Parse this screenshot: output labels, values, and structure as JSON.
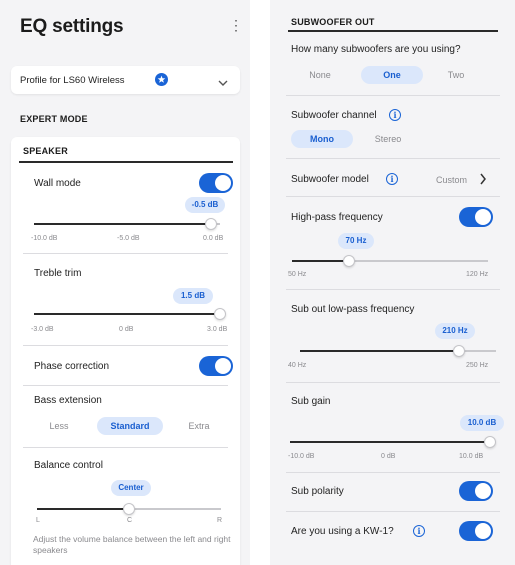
{
  "left": {
    "title": "EQ settings",
    "profile": {
      "label": "Profile for LS60 Wireless",
      "badge_icon": "star-icon"
    },
    "expert_mode": "EXPERT MODE",
    "speaker_section": "SPEAKER",
    "wall_mode": {
      "label": "Wall mode",
      "value": "-0.5 dB",
      "on": true,
      "ticks": [
        "-10.0 dB",
        "-5.0 dB",
        "0.0 dB"
      ]
    },
    "treble_trim": {
      "label": "Treble trim",
      "value": "1.5 dB",
      "ticks": [
        "-3.0 dB",
        "0 dB",
        "3.0 dB"
      ]
    },
    "phase_correction": {
      "label": "Phase correction",
      "on": true
    },
    "bass_extension": {
      "label": "Bass extension",
      "options": [
        "Less",
        "Standard",
        "Extra"
      ],
      "selected": "Standard"
    },
    "balance_control": {
      "label": "Balance control",
      "value": "Center",
      "ticks": [
        "L",
        "C",
        "R"
      ],
      "hint": "Adjust the volume balance between the left and right speakers"
    }
  },
  "right": {
    "section": "SUBWOOFER OUT",
    "how_many": {
      "label": "How many subwoofers are you using?",
      "options": [
        "None",
        "One",
        "Two"
      ],
      "selected": "One"
    },
    "channel": {
      "label": "Subwoofer channel",
      "options": [
        "Mono",
        "Stereo"
      ],
      "selected": "Mono"
    },
    "model": {
      "label": "Subwoofer model",
      "value": "Custom"
    },
    "high_pass": {
      "label": "High-pass frequency",
      "value": "70 Hz",
      "on": true,
      "ticks": [
        "50 Hz",
        "120 Hz"
      ]
    },
    "low_pass": {
      "label": "Sub out low-pass frequency",
      "value": "210 Hz",
      "ticks": [
        "40 Hz",
        "250 Hz"
      ]
    },
    "sub_gain": {
      "label": "Sub gain",
      "value": "10.0 dB",
      "ticks": [
        "-10.0 dB",
        "0 dB",
        "10.0 dB"
      ]
    },
    "sub_polarity": {
      "label": "Sub polarity",
      "on": true
    },
    "kw1": {
      "label": "Are you using a KW-1?",
      "on": true
    }
  },
  "colors": {
    "accent": "#1a64d6",
    "pill_bg": "#dbe7fb"
  },
  "slider_levels": {
    "wall_mode": 0.95,
    "treble_trim": 1.0,
    "balance_control": 0.5,
    "high_pass": 0.29,
    "low_pass": 0.81,
    "sub_gain": 1.0
  }
}
